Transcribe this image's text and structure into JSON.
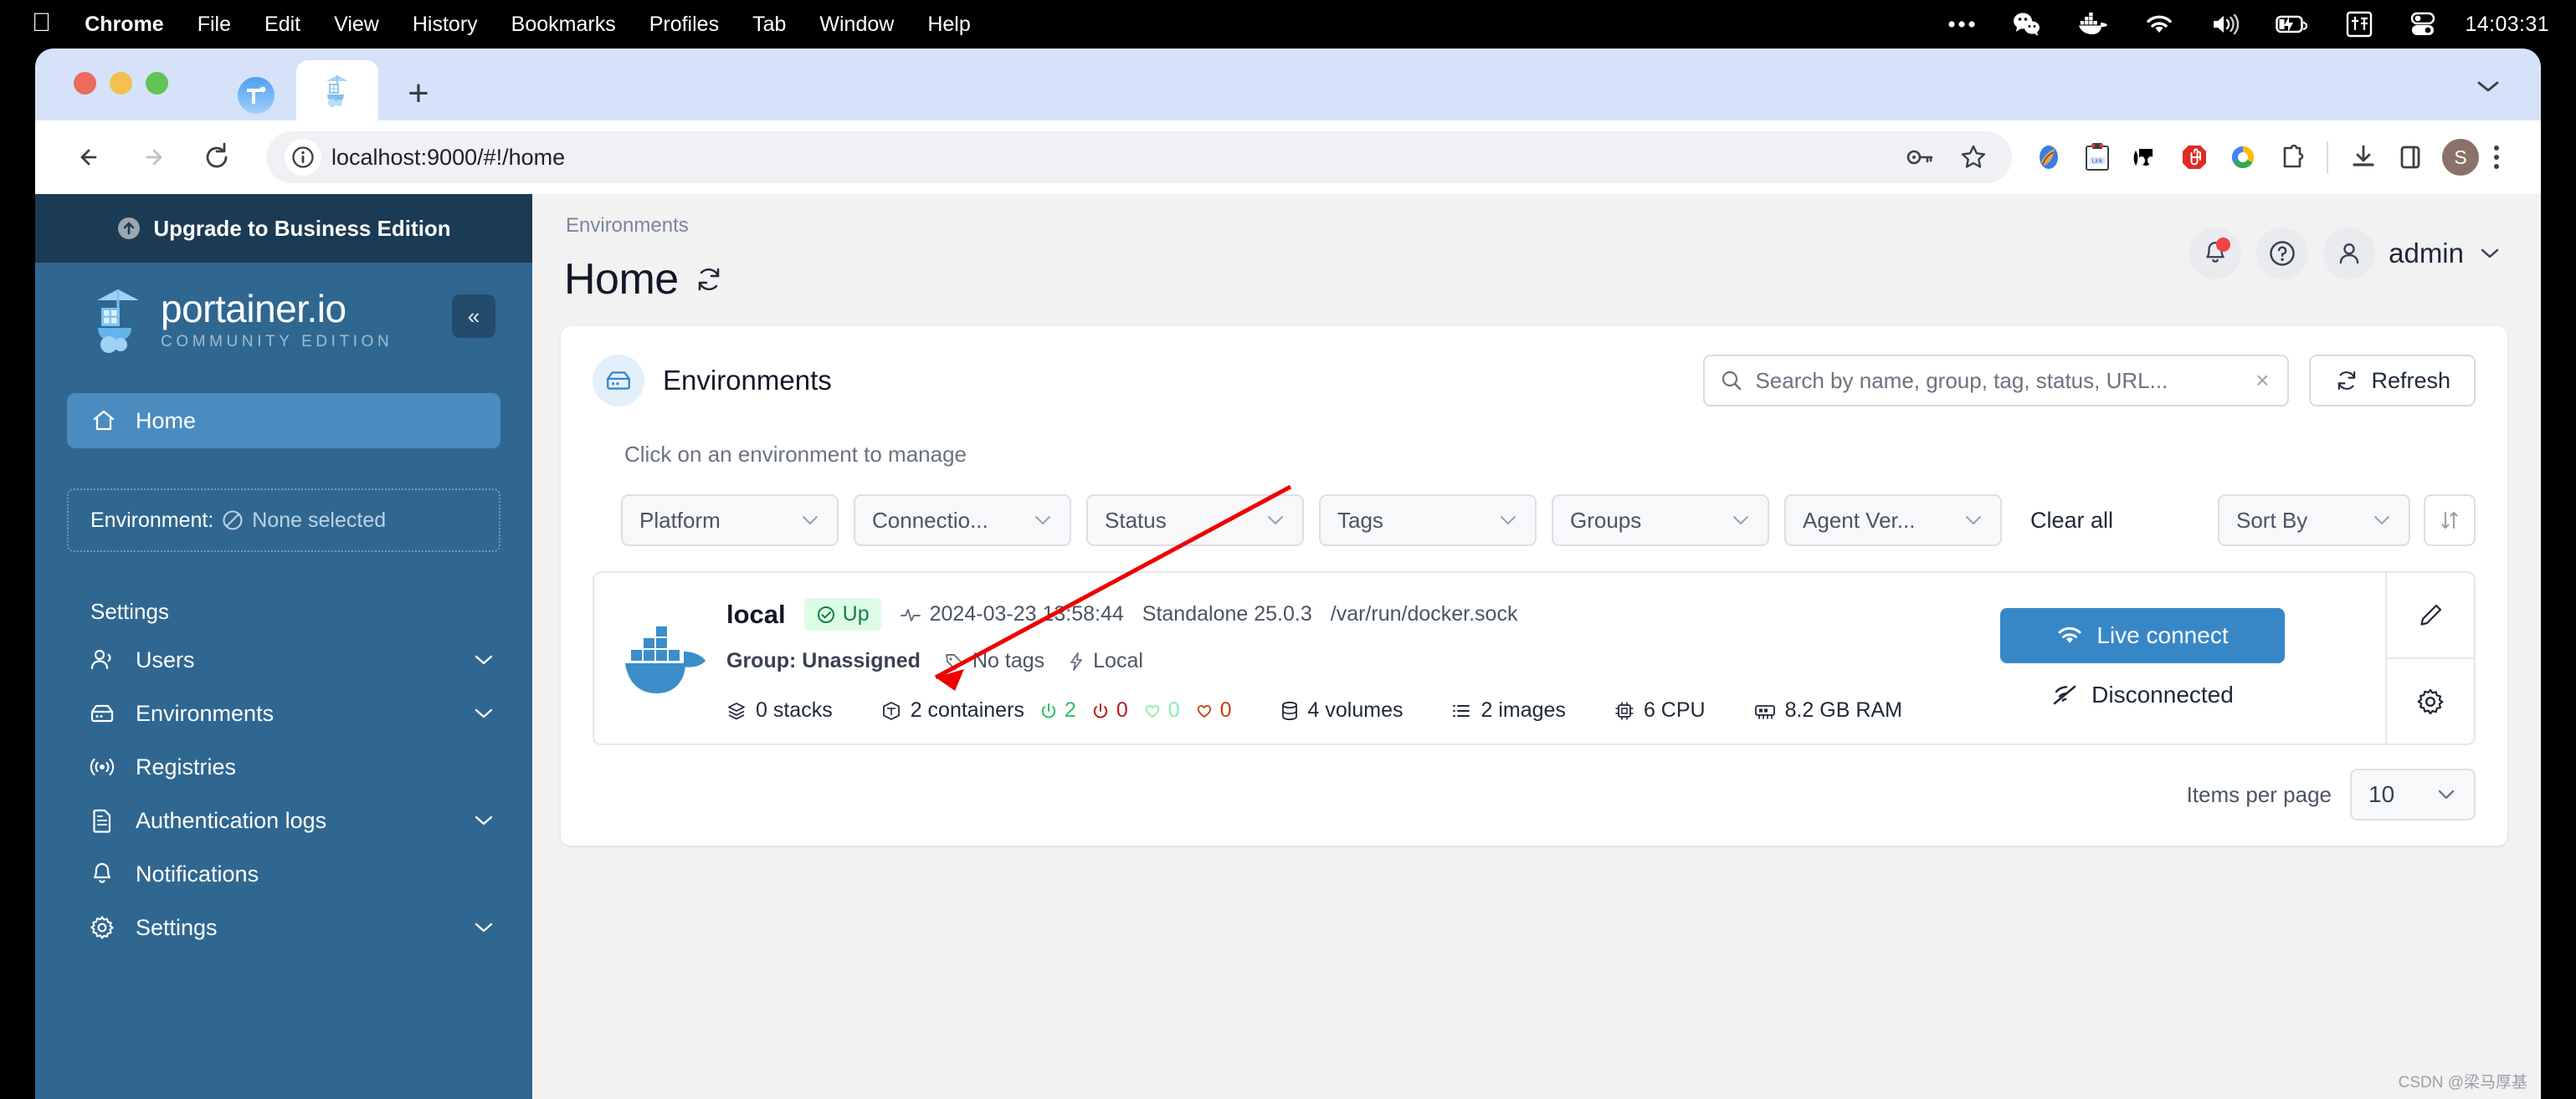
{
  "menubar": {
    "apple": "apple-logo",
    "items": [
      "Chrome",
      "File",
      "Edit",
      "View",
      "History",
      "Bookmarks",
      "Profiles",
      "Tab",
      "Window",
      "Help"
    ],
    "clock": "14:03:31",
    "status_icons": [
      "more-dots-icon",
      "wechat-icon",
      "docker-icon",
      "wifi-icon",
      "volume-icon",
      "battery-icon",
      "input-source-pinyin-icon",
      "control-center-icon"
    ]
  },
  "browser": {
    "tabs": [
      {
        "name": "pinned-tab-teams",
        "icon": "teams-icon"
      },
      {
        "name": "active-tab-portainer",
        "icon": "portainer-icon"
      }
    ],
    "new_tab_label": "+",
    "url": "localhost:9000/#!/home",
    "nav": {
      "back": "back-arrow-icon",
      "forward": "forward-arrow-icon",
      "reload": "reload-icon"
    },
    "omnibox_icons": [
      "site-info-icon",
      "password-key-icon",
      "bookmark-star-icon"
    ],
    "extensions": [
      "profile-paint-icon",
      "clipboard-link-icon",
      "black-eyes-icon",
      "adblock-stop-icon",
      "colorful-ring-icon",
      "extension-puzzle-icon"
    ],
    "toolbar_right": [
      "download-icon",
      "side-panel-icon"
    ],
    "profile_initial": "S",
    "menu": "kebab-menu-icon"
  },
  "sidebar": {
    "upgrade_banner": "Upgrade to Business Edition",
    "logo_title": "portainer.io",
    "logo_subtitle": "COMMUNITY EDITION",
    "collapse": "«",
    "home_label": "Home",
    "environment_label": "Environment:",
    "environment_value": "None selected",
    "section_title": "Settings",
    "items": [
      {
        "label": "Users",
        "icon": "users-icon",
        "expandable": true
      },
      {
        "label": "Environments",
        "icon": "environments-icon",
        "expandable": true
      },
      {
        "label": "Registries",
        "icon": "registries-icon",
        "expandable": false
      },
      {
        "label": "Authentication logs",
        "icon": "document-icon",
        "expandable": true
      },
      {
        "label": "Notifications",
        "icon": "bell-icon",
        "expandable": false
      },
      {
        "label": "Settings",
        "icon": "gear-icon",
        "expandable": true
      }
    ]
  },
  "header": {
    "breadcrumb": "Environments",
    "title": "Home",
    "refresh_icon": "refresh-icon",
    "notifications_icon": "bell-icon",
    "help_icon": "help-circle-icon",
    "user_icon": "user-icon",
    "user_name": "admin",
    "user_caret": "chevron-down-icon"
  },
  "card": {
    "title": "Environments",
    "icon": "environments-icon",
    "hint": "Click on an environment to manage",
    "search": {
      "placeholder": "Search by name, group, tag, status, URL...",
      "value": "",
      "icon": "search-icon",
      "clear": "×"
    },
    "refresh_button": "Refresh",
    "filters": [
      {
        "label": "Platform",
        "name": "filter-platform"
      },
      {
        "label": "Connectio...",
        "name": "filter-connection"
      },
      {
        "label": "Status",
        "name": "filter-status"
      },
      {
        "label": "Tags",
        "name": "filter-tags"
      },
      {
        "label": "Groups",
        "name": "filter-groups"
      },
      {
        "label": "Agent Ver...",
        "name": "filter-agent-version"
      }
    ],
    "clear_all": "Clear all",
    "sort_by": "Sort By",
    "sort_toggle_icon": "sort-direction-icon"
  },
  "environment": {
    "name": "local",
    "status_badge": "Up",
    "status_icon": "check-circle-icon",
    "heartbeat_icon": "activity-icon",
    "last_seen": "2024-03-23 13:58:44",
    "engine": "Standalone 25.0.3",
    "socket": "/var/run/docker.sock",
    "group": "Group: Unassigned",
    "tags": "No tags",
    "tags_icon": "tag-icon",
    "type": "Local",
    "type_icon": "bolt-icon",
    "logo": "docker-whale-icon",
    "stats": [
      {
        "icon": "stacks-icon",
        "label": "0 stacks"
      },
      {
        "icon": "containers-icon",
        "label": "2 containers"
      },
      {
        "icon": "power-icon",
        "label": "2",
        "color": "#22c55e"
      },
      {
        "icon": "power-icon",
        "label": "0",
        "color": "#b91c1c"
      },
      {
        "icon": "heart-icon",
        "label": "0",
        "color": "#86efac"
      },
      {
        "icon": "heart-icon",
        "label": "0",
        "color": "#c2410c"
      },
      {
        "icon": "volumes-icon",
        "label": "4 volumes"
      },
      {
        "icon": "images-icon",
        "label": "2 images"
      },
      {
        "icon": "cpu-icon",
        "label": "6 CPU"
      },
      {
        "icon": "ram-icon",
        "label": "8.2 GB RAM"
      }
    ],
    "live_connect": "Live connect",
    "live_connect_icon": "wifi-icon",
    "disconnected": "Disconnected",
    "disconnected_icon": "wifi-off-icon",
    "edit_icon": "pencil-icon",
    "settings_icon": "gear-icon"
  },
  "pager": {
    "label": "Items per page",
    "value": "10",
    "caret": "chevron-down-icon"
  },
  "watermark": "CSDN @梁马厚基",
  "colors": {
    "sidebar": "#2f6791",
    "banner": "#1b3a54",
    "accent": "#3787c7",
    "up_badge_bg": "#dcfce7",
    "up_badge_fg": "#15803d",
    "annotation": "#ee0000"
  }
}
